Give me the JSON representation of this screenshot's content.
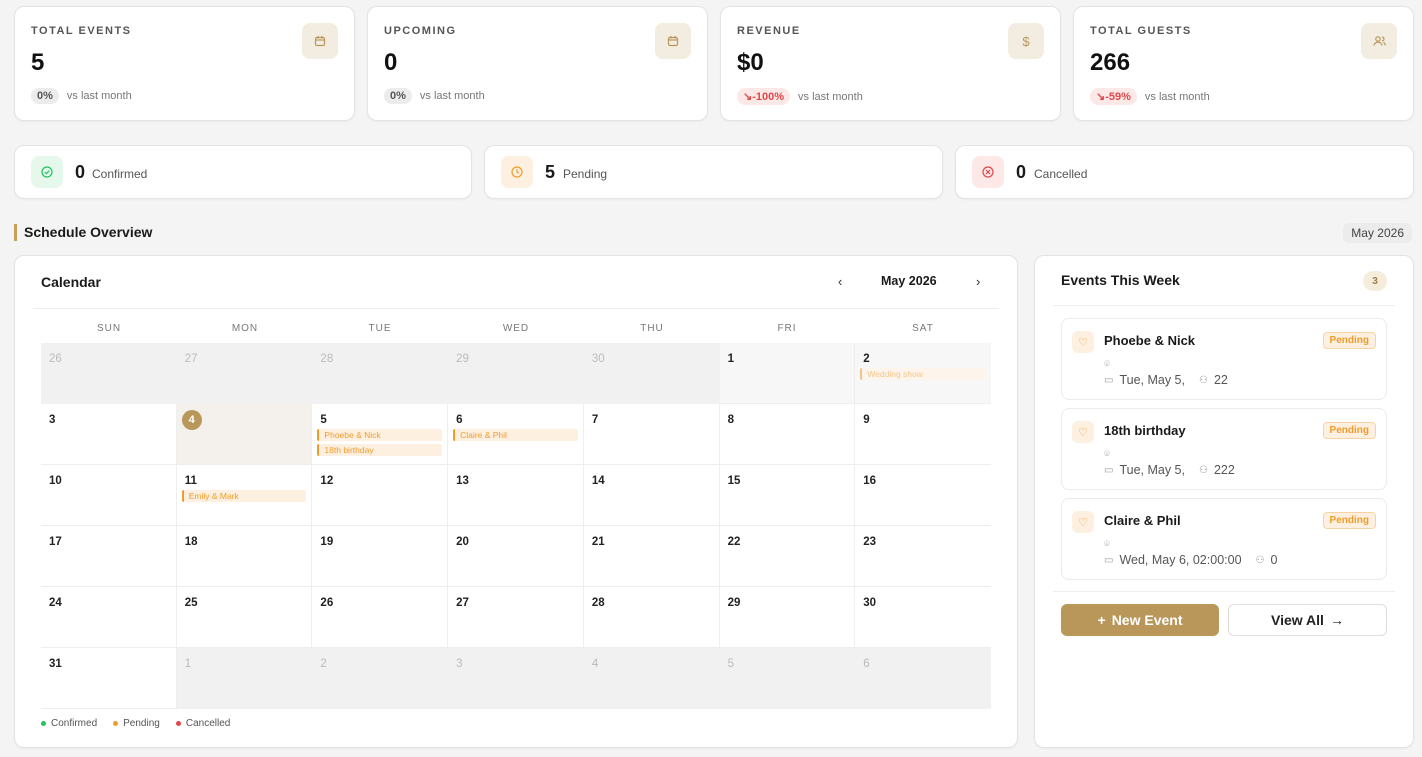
{
  "stats": [
    {
      "label": "TOTAL EVENTS",
      "value": "5",
      "change": "0%",
      "change_type": "neutral",
      "note": "vs last month",
      "icon": "calendar-icon"
    },
    {
      "label": "UPCOMING",
      "value": "0",
      "change": "0%",
      "change_type": "neutral",
      "note": "vs last month",
      "icon": "calendar-icon"
    },
    {
      "label": "REVENUE",
      "value": "$0",
      "change": "-100%",
      "change_type": "down",
      "note": "vs last month",
      "icon": "dollar-icon"
    },
    {
      "label": "TOTAL GUESTS",
      "value": "266",
      "change": "-59%",
      "change_type": "down",
      "note": "vs last month",
      "icon": "users-icon"
    }
  ],
  "statuses": [
    {
      "value": "0",
      "label": "Confirmed",
      "color": "#22c55e"
    },
    {
      "value": "5",
      "label": "Pending",
      "color": "#f29b2a"
    },
    {
      "value": "0",
      "label": "Cancelled",
      "color": "#e04848"
    }
  ],
  "section": {
    "title": "Schedule Overview",
    "month_badge": "May 2026"
  },
  "calendar": {
    "title": "Calendar",
    "month": "May 2026",
    "prev": "‹",
    "next": "›",
    "days_of_week": [
      "SUN",
      "MON",
      "TUE",
      "WED",
      "THU",
      "FRI",
      "SAT"
    ],
    "cells": [
      {
        "day": "26",
        "muted": true
      },
      {
        "day": "27",
        "muted": true
      },
      {
        "day": "28",
        "muted": true
      },
      {
        "day": "29",
        "muted": true
      },
      {
        "day": "30",
        "muted": true
      },
      {
        "day": "1",
        "weekend": true
      },
      {
        "day": "2",
        "weekend": true,
        "events": [
          {
            "name": "Wedding show",
            "faded": true
          }
        ]
      },
      {
        "day": "3"
      },
      {
        "day": "4",
        "today": true
      },
      {
        "day": "5",
        "events": [
          {
            "name": "Phoebe & Nick"
          },
          {
            "name": "18th birthday"
          }
        ]
      },
      {
        "day": "6",
        "events": [
          {
            "name": "Claire & Phil"
          }
        ]
      },
      {
        "day": "7"
      },
      {
        "day": "8"
      },
      {
        "day": "9"
      },
      {
        "day": "10"
      },
      {
        "day": "11",
        "events": [
          {
            "name": "Emily & Mark"
          }
        ]
      },
      {
        "day": "12"
      },
      {
        "day": "13"
      },
      {
        "day": "14"
      },
      {
        "day": "15"
      },
      {
        "day": "16"
      },
      {
        "day": "17"
      },
      {
        "day": "18"
      },
      {
        "day": "19"
      },
      {
        "day": "20"
      },
      {
        "day": "21"
      },
      {
        "day": "22"
      },
      {
        "day": "23"
      },
      {
        "day": "24"
      },
      {
        "day": "25"
      },
      {
        "day": "26"
      },
      {
        "day": "27"
      },
      {
        "day": "28"
      },
      {
        "day": "29"
      },
      {
        "day": "30"
      },
      {
        "day": "31"
      },
      {
        "day": "1",
        "muted": true
      },
      {
        "day": "2",
        "muted": true
      },
      {
        "day": "3",
        "muted": true
      },
      {
        "day": "4",
        "muted": true
      },
      {
        "day": "5",
        "muted": true
      },
      {
        "day": "6",
        "muted": true
      }
    ],
    "legend": [
      {
        "label": "Confirmed",
        "color": "#22c55e"
      },
      {
        "label": "Pending",
        "color": "#f29b2a"
      },
      {
        "label": "Cancelled",
        "color": "#e04848"
      }
    ]
  },
  "week": {
    "title": "Events This Week",
    "count": "3",
    "events": [
      {
        "name": "Phoebe & Nick",
        "status": "Pending",
        "date": "Tue, May 5,",
        "guests": "22"
      },
      {
        "name": "18th birthday",
        "status": "Pending",
        "date": "Tue, May 5,",
        "guests": "222"
      },
      {
        "name": "Claire & Phil",
        "status": "Pending",
        "date": "Wed, May 6, 02:00:00",
        "guests": "0"
      }
    ],
    "new_event_label": "New Event",
    "view_all_label": "View All"
  }
}
